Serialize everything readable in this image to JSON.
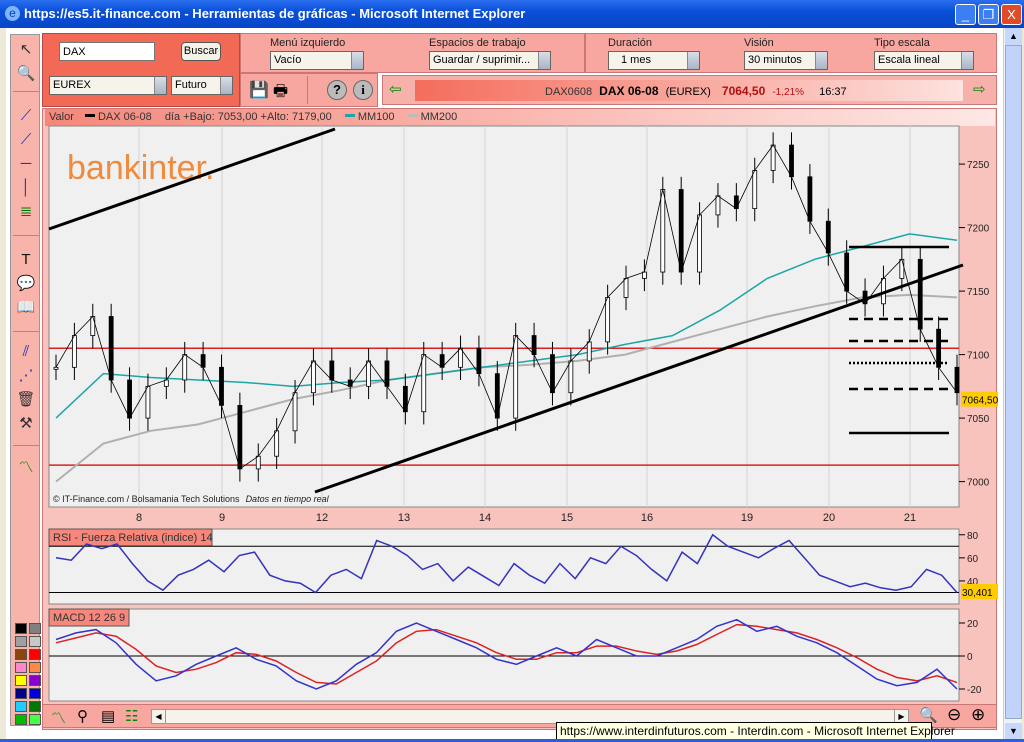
{
  "window": {
    "title": "https://es5.it-finance.com - Herramientas de gráficas - Microsoft Internet Explorer",
    "minimize": "_",
    "restore": "❐",
    "close": "X"
  },
  "search": {
    "value": "DAX",
    "button": "Buscar",
    "market": "EUREX",
    "type": "Futuro"
  },
  "settings": {
    "left_menu": {
      "label": "Menú izquierdo",
      "value": "Vacío"
    },
    "workspaces": {
      "label": "Espacios de trabajo",
      "value": "Guardar / suprimir..."
    },
    "duration": {
      "label": "Duración",
      "value": "1 mes"
    },
    "vision": {
      "label": "Visión",
      "value": "30 minutos"
    },
    "scale": {
      "label": "Tipo escala",
      "value": "Escala lineal"
    }
  },
  "quote": {
    "code": "DAX0608",
    "name": "DAX 06-08",
    "market": "(EUREX)",
    "price": "7064,50",
    "change": "-1,21%",
    "time": "16:37"
  },
  "legend": {
    "value": "Valor",
    "series": "DAX 06-08",
    "range": "día +Bajo: 7053,00 +Alto: 7179,00",
    "mm100": "MM100",
    "mm200": "MM200"
  },
  "brand": "bankinter.",
  "credits": "© IT-Finance.com / Bolsamania Tech Solutions",
  "realtime": "Datos en tiempo real",
  "rsi_title": "RSI - Fuerza Relativa (indice) 14",
  "macd_title": "MACD 12 26 9",
  "status_tooltip": "https://www.interdinfuturos.com - Interdin.com - Microsoft Internet Explorer",
  "palette": [
    "#000000",
    "#808080",
    "#a0a0a0",
    "#c8c8c8",
    "#8b4513",
    "#ff0000",
    "#ff88cc",
    "#ff8844",
    "#ffff00",
    "#8800cc",
    "#000088",
    "#0000dd",
    "#22ccff",
    "#007700",
    "#00bb00",
    "#44ff44"
  ],
  "colors": {
    "price": "#000000",
    "mm100": "#1aa6a6",
    "mm200": "#b0b0b0",
    "support": "#e02020",
    "rsi": "#3333bb",
    "macd": "#3333cc",
    "signal": "#dd2222",
    "last_badge": "#ffcc00"
  },
  "chart_data": [
    {
      "type": "line",
      "name": "price",
      "ylim": [
        6980,
        7280
      ],
      "yticks": [
        "7000",
        "7050",
        "7100",
        "7150",
        "7200",
        "7250"
      ],
      "xticks": [
        "8",
        "9",
        "12",
        "13",
        "14",
        "15",
        "16",
        "19",
        "20",
        "21"
      ],
      "series": [
        {
          "name": "DAX 06-08",
          "values": [
            7090,
            7115,
            7130,
            7080,
            7050,
            7075,
            7080,
            7100,
            7090,
            7060,
            7010,
            7020,
            7040,
            7070,
            7095,
            7080,
            7075,
            7095,
            7075,
            7055,
            7100,
            7090,
            7105,
            7085,
            7050,
            7115,
            7100,
            7070,
            7095,
            7110,
            7145,
            7160,
            7165,
            7230,
            7165,
            7210,
            7225,
            7215,
            7245,
            7265,
            7240,
            7205,
            7180,
            7150,
            7140,
            7160,
            7175,
            7120,
            7090,
            7070
          ]
        },
        {
          "name": "MM100",
          "values": [
            7050,
            7085,
            7082,
            7080,
            7078,
            7075,
            7078,
            7080,
            7085,
            7090,
            7095,
            7100,
            7108,
            7115,
            7135,
            7160,
            7175,
            7185,
            7195,
            7190
          ]
        },
        {
          "name": "MM200",
          "values": [
            7000,
            7030,
            7040,
            7045,
            7055,
            7065,
            7072,
            7080,
            7085,
            7090,
            7092,
            7095,
            7100,
            7110,
            7120,
            7130,
            7138,
            7145,
            7147,
            7145
          ]
        }
      ],
      "horizontal_lines": [
        7105,
        7013
      ],
      "last_value": "7064,50"
    },
    {
      "type": "line",
      "name": "RSI",
      "ylim": [
        20,
        85
      ],
      "yticks": [
        "80",
        "60",
        "40"
      ],
      "reference_lines": [
        70,
        30
      ],
      "values": [
        60,
        58,
        72,
        68,
        72,
        55,
        40,
        32,
        45,
        50,
        58,
        48,
        62,
        65,
        45,
        40,
        38,
        30,
        45,
        50,
        42,
        75,
        70,
        62,
        50,
        55,
        40,
        52,
        44,
        36,
        55,
        45,
        38,
        55,
        42,
        60,
        55,
        70,
        62,
        50,
        40,
        65,
        55,
        80,
        70,
        65,
        60,
        68,
        75,
        60,
        45,
        40,
        35,
        38,
        34,
        32,
        35,
        50,
        45,
        30
      ],
      "last_value": "30,401"
    },
    {
      "type": "line",
      "name": "MACD",
      "ylim": [
        -28,
        28
      ],
      "yticks": [
        "20",
        "0",
        "-20"
      ],
      "series": [
        {
          "name": "MACD",
          "values": [
            10,
            14,
            16,
            8,
            -5,
            -15,
            -12,
            -5,
            0,
            5,
            -2,
            -6,
            -15,
            -20,
            -15,
            -5,
            2,
            15,
            20,
            15,
            10,
            5,
            -2,
            -5,
            0,
            5,
            0,
            10,
            5,
            0,
            0,
            5,
            10,
            18,
            22,
            15,
            18,
            12,
            8,
            2,
            -6,
            -14,
            -18,
            -16,
            -8,
            -20
          ]
        },
        {
          "name": "Signal",
          "values": [
            8,
            11,
            14,
            12,
            4,
            -6,
            -10,
            -8,
            -4,
            2,
            1,
            -3,
            -10,
            -16,
            -17,
            -10,
            -3,
            8,
            15,
            16,
            12,
            8,
            2,
            -2,
            -2,
            2,
            2,
            6,
            6,
            3,
            1,
            3,
            7,
            13,
            19,
            18,
            16,
            14,
            10,
            5,
            -1,
            -8,
            -13,
            -15,
            -12,
            -16
          ]
        }
      ]
    }
  ]
}
